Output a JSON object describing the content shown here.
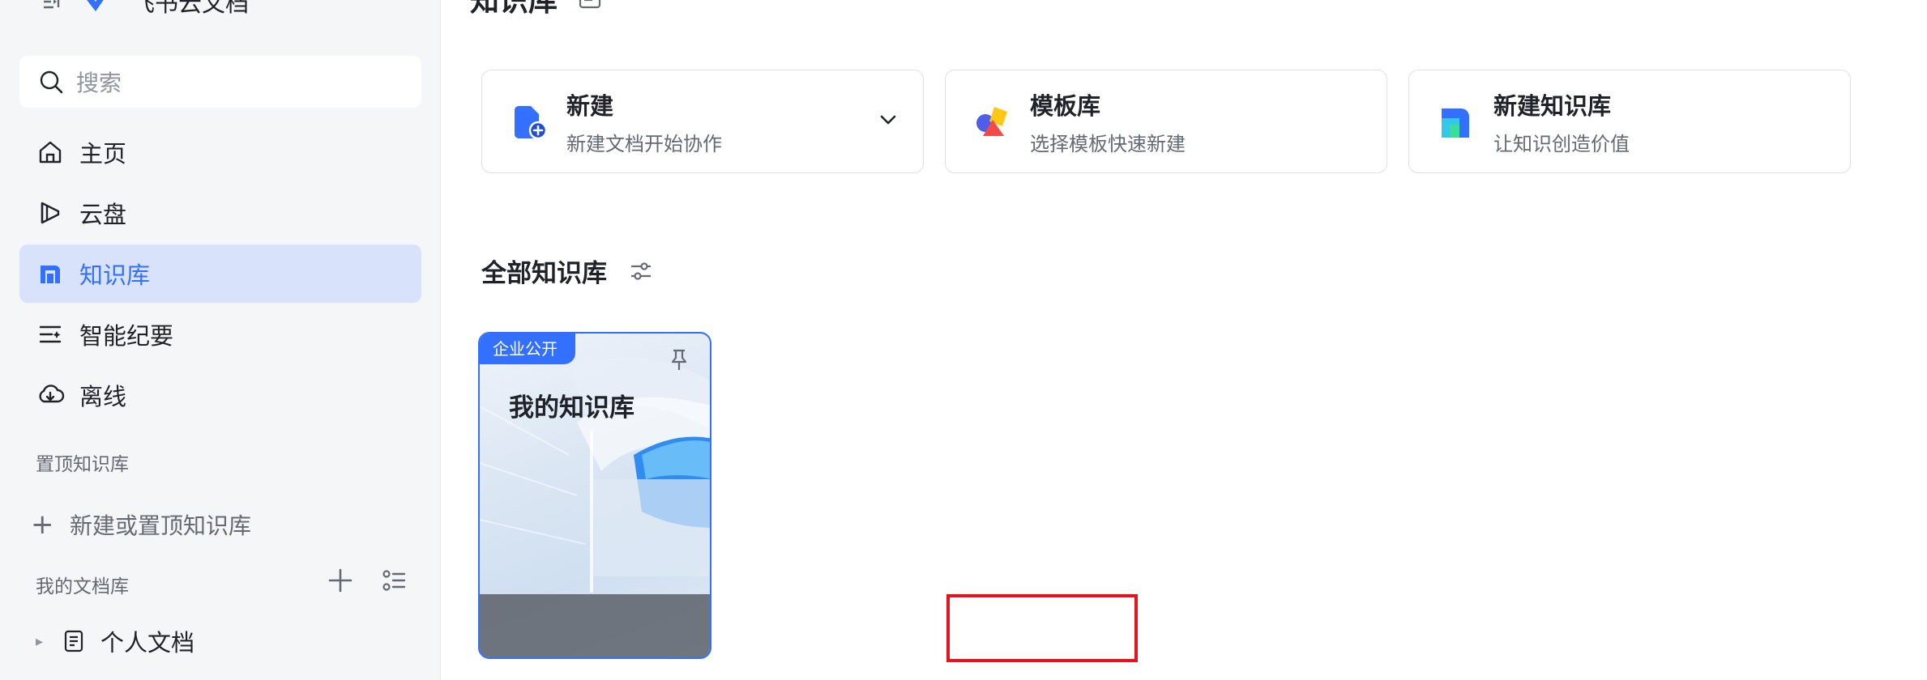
{
  "sidebar": {
    "app_name": "飞书云文档",
    "search_placeholder": "搜索",
    "nav": [
      {
        "label": "主页",
        "icon": "home-icon"
      },
      {
        "label": "云盘",
        "icon": "cloud-drive-icon"
      },
      {
        "label": "知识库",
        "icon": "knowledge-base-icon",
        "active": true
      },
      {
        "label": "智能纪要",
        "icon": "smart-notes-icon"
      },
      {
        "label": "离线",
        "icon": "offline-icon"
      }
    ],
    "pinned_title": "置顶知识库",
    "add_pinned_label": "新建或置顶知识库",
    "my_docs_title": "我的文档库",
    "tree": [
      {
        "label": "个人文档",
        "icon": "document-icon"
      }
    ]
  },
  "main": {
    "title": "知识库",
    "cards": [
      {
        "title": "新建",
        "subtitle": "新建文档开始协作"
      },
      {
        "title": "模板库",
        "subtitle": "选择模板快速新建"
      },
      {
        "title": "新建知识库",
        "subtitle": "让知识创造价值"
      }
    ],
    "all_title": "全部知识库",
    "kb": {
      "badge": "企业公开",
      "name": "我的知识库",
      "settings_label": "知识库设置"
    }
  },
  "colors": {
    "accent": "#3370ff",
    "sidebar_bg": "#f5f6f7",
    "active_bg": "#d9e2fb",
    "highlight_border": "#e5141c"
  }
}
